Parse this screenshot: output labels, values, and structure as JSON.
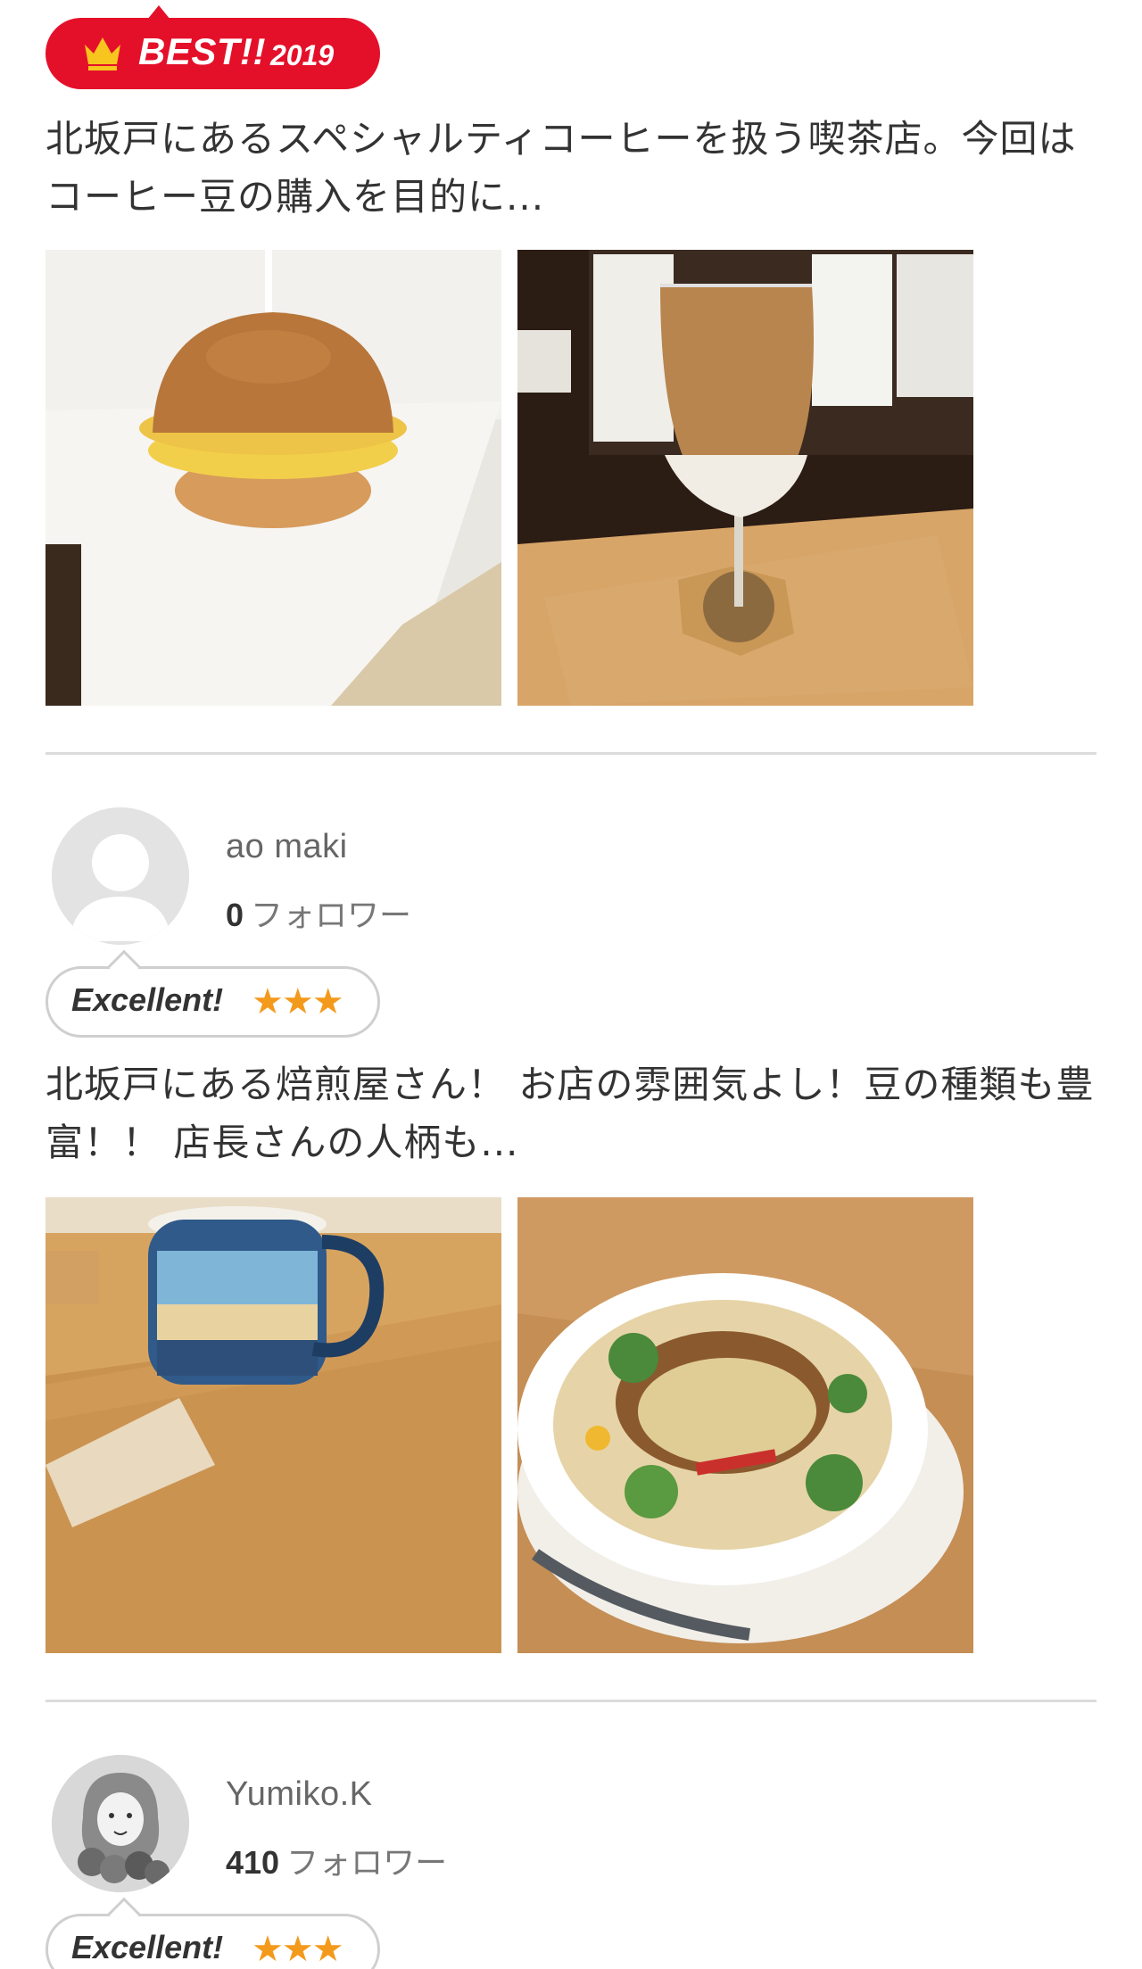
{
  "reviews": [
    {
      "badge": {
        "label": "BEST!!",
        "year": "2019"
      },
      "text": "北坂戸にあるスペシャルティコーヒーを扱う喫茶店。今回はコーヒー豆の購入を目的に...",
      "photos": [
        "egg-sandwich-burger",
        "iced-cafe-latte"
      ]
    },
    {
      "reviewer": {
        "name": "ao maki",
        "followers_count": "0",
        "followers_label": "フォロワー"
      },
      "rating": {
        "label": "Excellent!",
        "stars": "★★★"
      },
      "text": "北坂戸にある焙煎屋さん！ お店の雰囲気よし！豆の種類も豊富！！ 店長さんの人柄も...",
      "photos": [
        "butterfly-mug-coffee",
        "baked-curry-doria"
      ]
    },
    {
      "reviewer": {
        "name": "Yumiko.K",
        "followers_count": "410",
        "followers_label": "フォロワー"
      },
      "rating": {
        "label": "Excellent!",
        "stars": "★★★"
      }
    }
  ],
  "colors": {
    "best_red": "#e4102a",
    "star_orange": "#f39a1c",
    "divider": "#dcdcdc"
  }
}
